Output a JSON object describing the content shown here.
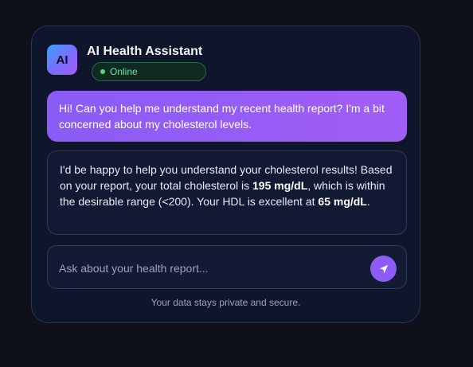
{
  "header": {
    "avatar_text": "AI",
    "title": "AI Health Assistant",
    "status": "Online"
  },
  "messages": {
    "user": "Hi! Can you help me understand my recent health report? I'm a bit concerned about my cholesterol levels.",
    "assistant": {
      "part1": "I'd be happy to help you understand your cholesterol results! Based on your report, your total cholesterol is ",
      "total_value": "195 mg/dL",
      "part2": ", which is within the desirable range (<200). Your HDL is excellent at ",
      "hdl_value": "65 mg/dL",
      "part3": "."
    }
  },
  "input": {
    "placeholder": "Ask about your health report...",
    "value": ""
  },
  "footer": "Your data stays private and secure.",
  "colors": {
    "accent": "#8b5cf6",
    "status_green": "#4ade80"
  },
  "icons": {
    "send": "send-arrow-icon",
    "status": "status-dot-icon"
  }
}
